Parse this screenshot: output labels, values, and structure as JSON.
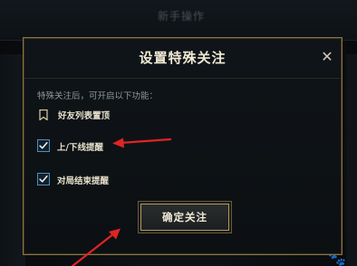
{
  "background": {
    "title": "新手操作"
  },
  "dialog": {
    "title": "设置特殊关注",
    "close_symbol": "✕",
    "hint": "特殊关注后，可开启以下功能：",
    "pin_feature_label": "好友列表置顶",
    "options": [
      {
        "label": "上/下线提醒",
        "checked": true
      },
      {
        "label": "对局结束提醒",
        "checked": true
      }
    ],
    "confirm_label": "确定关注"
  },
  "colors": {
    "accent_gold": "#8a7441",
    "checkbox_blue": "#4b8fb8",
    "annotation_red": "#e02424"
  }
}
